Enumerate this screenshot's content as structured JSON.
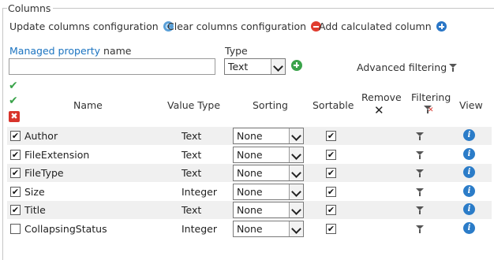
{
  "section": {
    "title": "Columns"
  },
  "actions": {
    "update_label": "Update columns configuration",
    "clear_label": "Clear columns configuration",
    "add_label": "Add calculated column"
  },
  "form": {
    "managed_property_link": "Managed property",
    "managed_property_suffix": " name",
    "type_label": "Type",
    "type_value": "Text",
    "advanced_filtering_label": "Advanced filtering"
  },
  "table": {
    "headers": {
      "name": "Name",
      "value_type": "Value Type",
      "sorting": "Sorting",
      "sortable": "Sortable",
      "remove": "Remove",
      "filtering": "Filtering",
      "view": "View"
    },
    "rows": [
      {
        "checked": true,
        "name": "Author",
        "value_type": "Text",
        "sorting": "None",
        "sortable": true
      },
      {
        "checked": true,
        "name": "FileExtension",
        "value_type": "Text",
        "sorting": "None",
        "sortable": true
      },
      {
        "checked": true,
        "name": "FileType",
        "value_type": "Text",
        "sorting": "None",
        "sortable": true
      },
      {
        "checked": true,
        "name": "Size",
        "value_type": "Integer",
        "sorting": "None",
        "sortable": true
      },
      {
        "checked": true,
        "name": "Title",
        "value_type": "Text",
        "sorting": "None",
        "sortable": true
      },
      {
        "checked": false,
        "name": "CollapsingStatus",
        "value_type": "Integer",
        "sorting": "None",
        "sortable": true
      }
    ]
  },
  "colors": {
    "link": "#1a73c0",
    "info": "#2b7cc8",
    "alt_row": "#f0f0f0"
  }
}
